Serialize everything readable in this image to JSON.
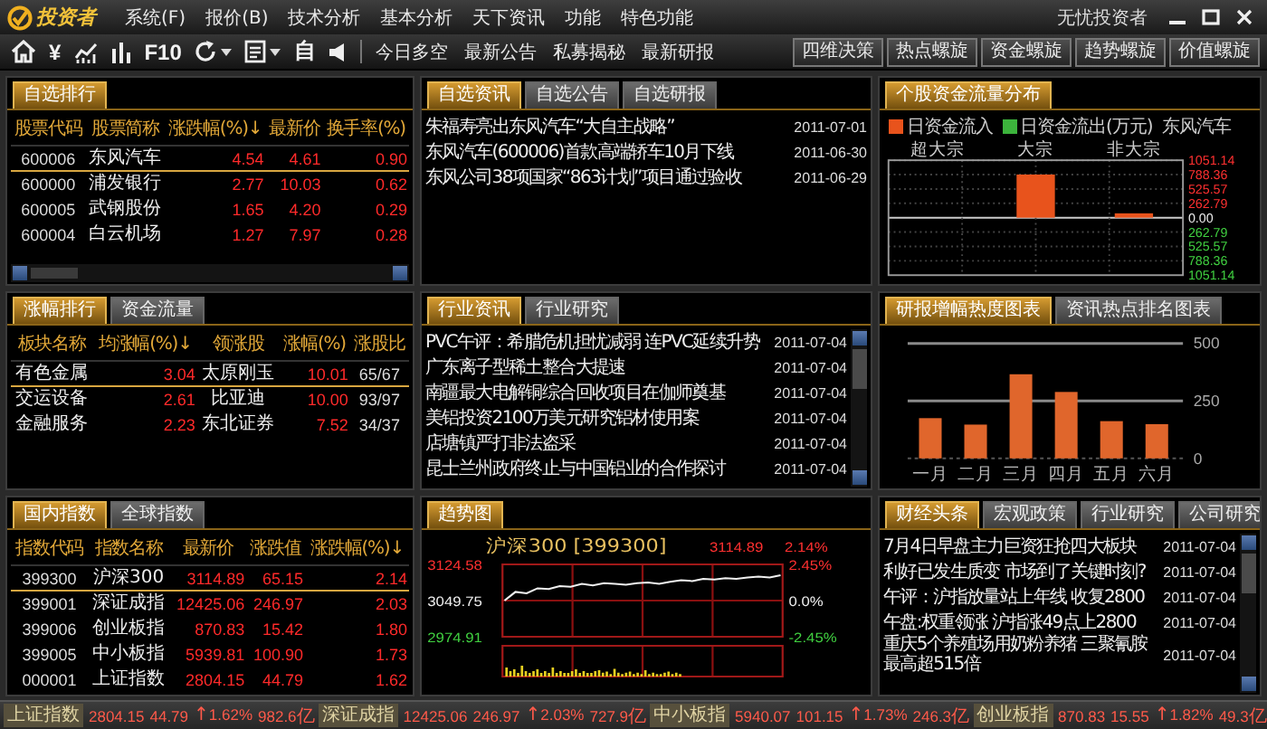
{
  "window": {
    "logo": "投资者",
    "menu": [
      "系统(F)",
      "报价(B)",
      "技术分析",
      "基本分析",
      "天下资讯",
      "功能",
      "特色功能"
    ],
    "title": "无忧投资者"
  },
  "toolbar": {
    "glyphs": [
      "¥",
      "F10",
      "自"
    ],
    "links": [
      "今日多空",
      "最新公告",
      "私募揭秘",
      "最新研报"
    ],
    "buttons": [
      "四维决策",
      "热点螺旋",
      "资金螺旋",
      "趋势螺旋",
      "价值螺旋"
    ]
  },
  "panels": [
    {
      "kind": "table",
      "scrollbar": true,
      "tabs": [
        {
          "label": "自选排行",
          "selected": true
        }
      ],
      "columns": [
        {
          "label": "股票代码",
          "kind": "code"
        },
        {
          "label": "股票简称",
          "kind": "name"
        },
        {
          "label": "涨跌幅(%)↓",
          "kind": "change"
        },
        {
          "label": "最新价",
          "kind": "change"
        },
        {
          "label": "换手率(%)",
          "kind": "change"
        }
      ],
      "rows": [
        {
          "cells": [
            "600006",
            "东风汽车",
            "4.54",
            "4.61",
            "0.90"
          ],
          "selected": true
        },
        {
          "cells": [
            "600000",
            "浦发银行",
            "2.77",
            "10.03",
            "0.62"
          ],
          "selected": false
        },
        {
          "cells": [
            "600005",
            "武钢股份",
            "1.65",
            "4.20",
            "0.29"
          ],
          "selected": false
        },
        {
          "cells": [
            "600004",
            "白云机场",
            "1.27",
            "7.97",
            "0.28"
          ],
          "selected": false
        }
      ]
    },
    {
      "kind": "news",
      "tabs": [
        {
          "label": "自选资讯",
          "selected": true
        },
        {
          "label": "自选公告",
          "selected": false
        },
        {
          "label": "自选研报",
          "selected": false
        }
      ],
      "items": [
        {
          "title": "朱福寿亮出东风汽车“大自主战略”",
          "date": "2011-07-01"
        },
        {
          "title": "东风汽车(600006)首款高端轿车10月下线",
          "date": "2011-06-30"
        },
        {
          "title": "东风公司38项国家“863计划”项目通过验收",
          "date": "2011-06-29"
        }
      ]
    },
    {
      "kind": "flow_chart",
      "tabs": [
        {
          "label": "个股资金流量分布",
          "selected": true
        }
      ],
      "subject": "东风汽车",
      "chart_data": {
        "type": "bar",
        "grid": true,
        "categories": [
          "超大宗",
          "大宗",
          "非大宗"
        ],
        "series": [
          {
            "name": "日资金流入",
            "color": "#e8531c",
            "values": [
              0,
              790,
              80
            ]
          },
          {
            "name": "日资金流出(万元)",
            "color": "#3cb43c",
            "values": [
              0,
              0,
              0
            ]
          }
        ],
        "ylim": [
          0,
          1051.14
        ],
        "yticks": [
          {
            "value": 1051.14,
            "label": "1051.14"
          },
          {
            "value": 788.36,
            "label": "788.36"
          },
          {
            "value": 525.57,
            "label": "525.57"
          },
          {
            "value": 262.79,
            "label": "262.79"
          },
          {
            "value": 0,
            "label": "0.00"
          }
        ]
      },
      "outflow_ticks": [
        "262.79",
        "525.57",
        "788.36",
        "1051.14"
      ]
    },
    {
      "kind": "table",
      "tabs": [
        {
          "label": "涨幅排行",
          "selected": true
        },
        {
          "label": "资金流量",
          "selected": false
        }
      ],
      "columns": [
        {
          "label": "板块名称",
          "kind": "name"
        },
        {
          "label": "均涨幅(%)↓",
          "kind": "change"
        },
        {
          "label": "领涨股",
          "kind": "name"
        },
        {
          "label": "涨幅(%)",
          "kind": "change"
        },
        {
          "label": "涨股比",
          "kind": "code"
        }
      ],
      "rows": [
        {
          "cells": [
            "有色金属",
            "3.04",
            "太原刚玉",
            "10.01",
            "65/67"
          ],
          "selected": true
        },
        {
          "cells": [
            "交运设备",
            "2.61",
            "比亚迪",
            "10.00",
            "93/97"
          ],
          "selected": false
        },
        {
          "cells": [
            "金融服务",
            "2.23",
            "东北证券",
            "7.52",
            "34/37"
          ],
          "selected": false
        }
      ]
    },
    {
      "kind": "news",
      "scrollbar": true,
      "tabs": [
        {
          "label": "行业资讯",
          "selected": true
        },
        {
          "label": "行业研究",
          "selected": false
        }
      ],
      "items": [
        {
          "title": "PVC午评：希腊危机担忧减弱 连PVC延续升势",
          "date": "2011-07-04"
        },
        {
          "title": "广东离子型稀土整合大提速",
          "date": "2011-07-04"
        },
        {
          "title": "南疆最大电解铜综合回收项目在伽师奠基",
          "date": "2011-07-04"
        },
        {
          "title": "美铝投资2100万美元研究铝材使用案",
          "date": "2011-07-04"
        },
        {
          "title": "店塘镇严打非法盗采",
          "date": "2011-07-04"
        },
        {
          "title": "昆士兰州政府终止与中国铝业的合作探讨",
          "date": "2011-07-04"
        }
      ]
    },
    {
      "kind": "bar_chart",
      "tabs": [
        {
          "label": "研报增幅热度图表",
          "selected": true
        },
        {
          "label": "资讯热点排名图表",
          "selected": false
        }
      ],
      "chart_data": {
        "type": "bar",
        "grid": true,
        "categories": [
          "一月",
          "二月",
          "三月",
          "四月",
          "五月",
          "六月"
        ],
        "series": [
          {
            "color": "#e0662c",
            "values": [
              175,
              147,
              366,
              289,
              162,
              149
            ]
          }
        ],
        "ylim": [
          0,
          500
        ],
        "yticks": [
          0,
          250,
          500
        ]
      }
    },
    {
      "kind": "table",
      "tabs": [
        {
          "label": "国内指数",
          "selected": true
        },
        {
          "label": "全球指数",
          "selected": false
        }
      ],
      "columns": [
        {
          "label": "指数代码",
          "kind": "code"
        },
        {
          "label": "指数名称",
          "kind": "name"
        },
        {
          "label": "最新价",
          "kind": "change"
        },
        {
          "label": "涨跌值",
          "kind": "change"
        },
        {
          "label": "涨跌幅(%)↓",
          "kind": "change"
        }
      ],
      "rows": [
        {
          "cells": [
            "399300",
            "沪深300",
            "3114.89",
            "65.15",
            "2.14"
          ],
          "selected": true
        },
        {
          "cells": [
            "399001",
            "深证成指",
            "12425.06",
            "246.97",
            "2.03"
          ],
          "selected": false
        },
        {
          "cells": [
            "399006",
            "创业板指",
            "870.83",
            "15.42",
            "1.80"
          ],
          "selected": false
        },
        {
          "cells": [
            "399005",
            "中小板指",
            "5939.81",
            "100.90",
            "1.73"
          ],
          "selected": false
        },
        {
          "cells": [
            "000001",
            "上证指数",
            "2804.15",
            "44.79",
            "1.62"
          ],
          "selected": false
        }
      ]
    },
    {
      "kind": "trend_chart",
      "tabs": [
        {
          "label": "趋势图",
          "selected": true
        }
      ],
      "trend": {
        "title": "沪深300 [399300]",
        "price": "3114.89",
        "change": "2.14%",
        "left_ticks": [
          {
            "label": "3124.58",
            "kind": "up"
          },
          {
            "label": "3049.75",
            "kind": "flat"
          },
          {
            "label": "2974.91",
            "kind": "down"
          }
        ],
        "right_ticks": [
          {
            "label": "2.45%",
            "kind": "up"
          },
          {
            "label": "0.0%",
            "kind": "flat"
          },
          {
            "label": "-2.45%",
            "kind": "down"
          }
        ]
      }
    },
    {
      "kind": "news",
      "scrollbar": true,
      "tabs": [
        {
          "label": "财经头条",
          "selected": true
        },
        {
          "label": "宏观政策",
          "selected": false
        },
        {
          "label": "行业研究",
          "selected": false
        },
        {
          "label": "公司研究",
          "selected": false
        }
      ],
      "items": [
        {
          "title": "7月4日早盘主力巨资狂抢四大板块",
          "date": "2011-07-04"
        },
        {
          "title": "利好已发生质变 市场到了关键时刻?",
          "date": "2011-07-04"
        },
        {
          "title": "午评：沪指放量站上年线 收复2800",
          "date": "2011-07-04"
        },
        {
          "title": "午盘:权重领涨 沪指涨49点上2800",
          "date": "2011-07-04"
        },
        {
          "title": "重庆5个养殖场用奶粉养猪 三聚氰胺最高超515倍",
          "date": "2011-07-04"
        }
      ]
    }
  ],
  "status_bar": {
    "items": [
      {
        "label": "上证指数",
        "values": [
          "2804.15",
          "44.79",
          "↑1.62%",
          "982.6亿"
        ]
      },
      {
        "label": "深证成指",
        "values": [
          "12425.06",
          "246.97",
          "↑2.03%",
          "727.9亿"
        ]
      },
      {
        "label": "中小板指",
        "values": [
          "5940.07",
          "101.15",
          "↑1.73%",
          "246.3亿"
        ]
      },
      {
        "label": "创业板指",
        "values": [
          "870.83",
          "15.55",
          "↑1.82%",
          "49.3亿"
        ]
      }
    ]
  }
}
